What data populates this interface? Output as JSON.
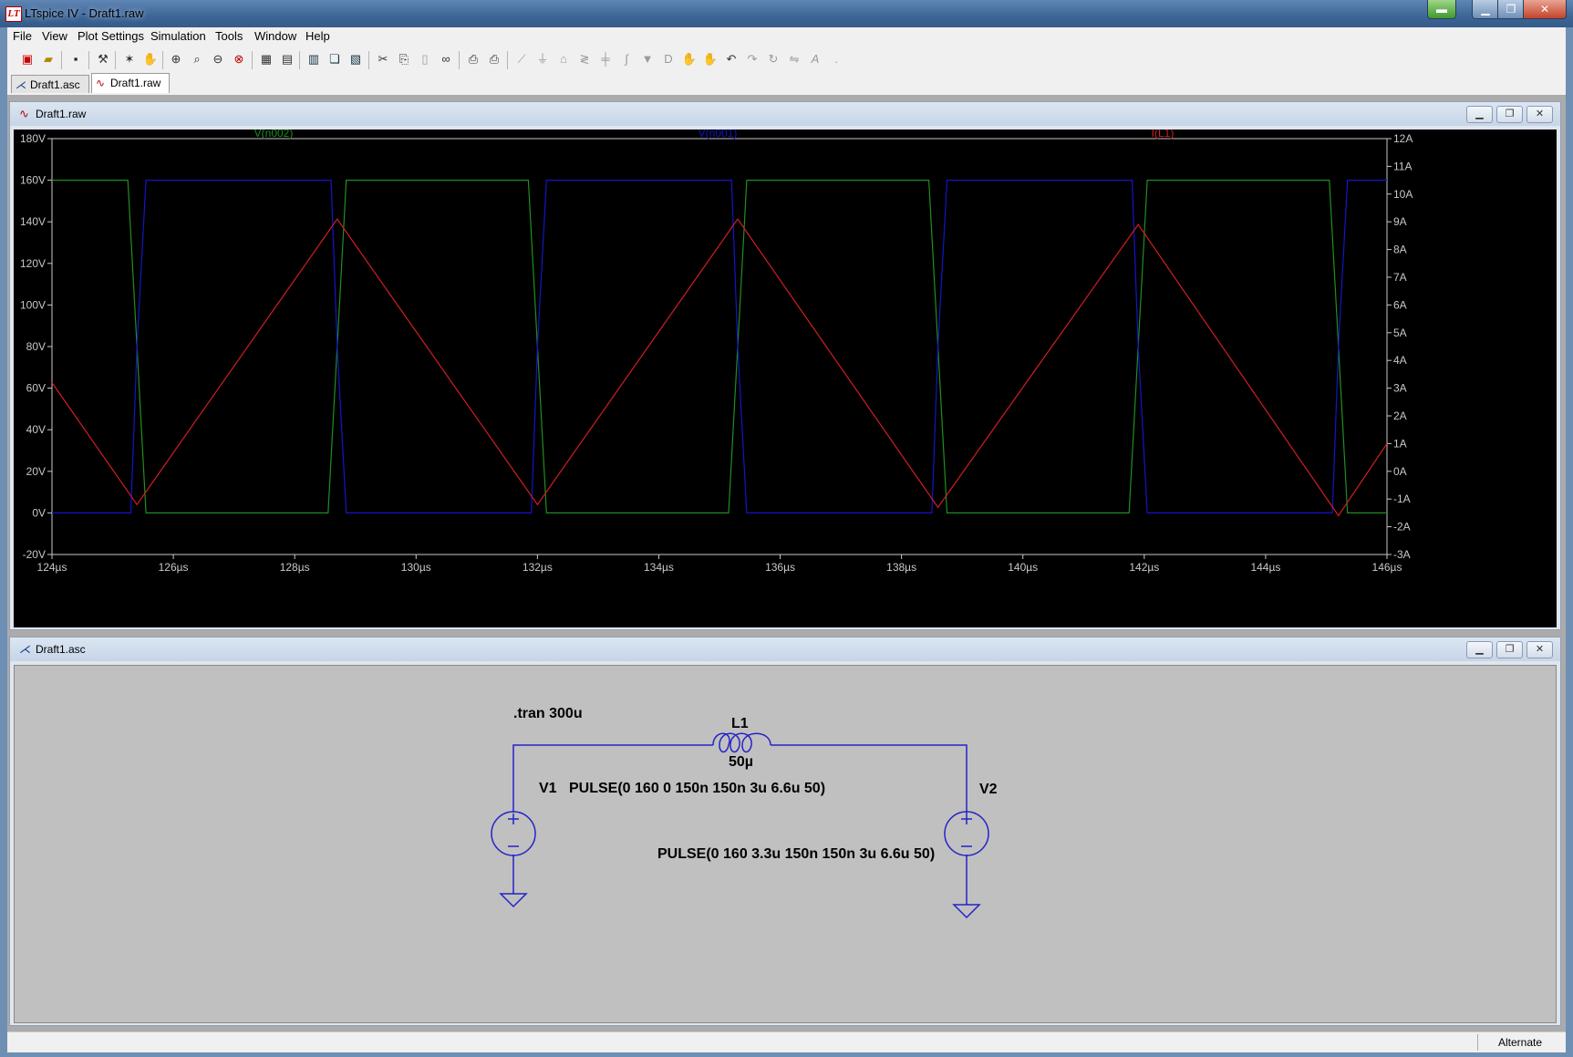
{
  "window": {
    "title": "LTspice IV - Draft1.raw",
    "app_icon": "LT"
  },
  "menu": [
    "File",
    "View",
    "Plot Settings",
    "Simulation",
    "Tools",
    "Window",
    "Help"
  ],
  "toolbar_icons": [
    "new-schematic-icon",
    "open-icon",
    "save-icon",
    "control-panel-icon",
    "run-icon",
    "halt-icon",
    "zoom-in-icon",
    "zoom-area-icon",
    "zoom-out-icon",
    "zoom-full-icon",
    "autorange-icon",
    "grid-icon",
    "tile-horizontal-icon",
    "cascade-icon",
    "tile-vertical-icon",
    "cut-icon",
    "copy-icon",
    "paste-icon",
    "find-icon",
    "print-preview-icon",
    "print-icon",
    "wire-icon",
    "ground-icon",
    "label-icon",
    "resistor-icon",
    "capacitor-icon",
    "inductor-icon",
    "diode-icon",
    "component-icon",
    "move-icon",
    "drag-icon",
    "undo-icon",
    "redo-icon",
    "rotate-icon",
    "mirror-icon",
    "text-icon",
    "spice-directive-icon"
  ],
  "tabs": [
    {
      "label": "Draft1.asc",
      "active": false
    },
    {
      "label": "Draft1.raw",
      "active": true
    }
  ],
  "plot_window": {
    "title": "Draft1.raw"
  },
  "schematic_window": {
    "title": "Draft1.asc"
  },
  "status": {
    "text": "Alternate"
  },
  "chart_data": {
    "type": "line",
    "xlabel": "",
    "ylabel": "",
    "x_ticks": [
      "124µs",
      "126µs",
      "128µs",
      "130µs",
      "132µs",
      "134µs",
      "136µs",
      "138µs",
      "140µs",
      "142µs",
      "144µs",
      "146µs"
    ],
    "xlim": [
      124,
      146
    ],
    "y_left_ticks": [
      "180V",
      "160V",
      "140V",
      "120V",
      "100V",
      "80V",
      "60V",
      "40V",
      "20V",
      "0V",
      "-20V"
    ],
    "ylim_left": [
      -20,
      180
    ],
    "y_right_ticks": [
      "12A",
      "11A",
      "10A",
      "9A",
      "8A",
      "7A",
      "6A",
      "5A",
      "4A",
      "3A",
      "2A",
      "1A",
      "0A",
      "-1A",
      "-2A",
      "-3A"
    ],
    "ylim_right": [
      -3,
      12
    ],
    "grid": false,
    "series": [
      {
        "name": "V(n002)",
        "color": "#1f8f1f",
        "axis": "left",
        "x": [
          124.0,
          125.25,
          125.4,
          125.55,
          128.55,
          128.7,
          128.85,
          131.85,
          132.0,
          132.15,
          135.15,
          135.3,
          135.45,
          138.45,
          138.6,
          138.75,
          141.75,
          141.9,
          142.05,
          145.05,
          145.2,
          145.35,
          146.0
        ],
        "y": [
          160,
          160,
          80,
          0,
          0,
          80,
          160,
          160,
          80,
          0,
          0,
          80,
          160,
          160,
          80,
          0,
          0,
          80,
          160,
          160,
          80,
          0,
          0
        ]
      },
      {
        "name": "V(n001)",
        "color": "#1414c8",
        "axis": "left",
        "x": [
          124.0,
          125.3,
          125.4,
          125.55,
          128.6,
          128.7,
          128.85,
          131.9,
          132.0,
          132.15,
          135.2,
          135.3,
          135.45,
          138.5,
          138.6,
          138.75,
          141.8,
          141.9,
          142.05,
          145.1,
          145.2,
          145.35,
          146.0
        ],
        "y": [
          0,
          0,
          80,
          160,
          160,
          80,
          0,
          0,
          80,
          160,
          160,
          80,
          0,
          0,
          80,
          160,
          160,
          80,
          0,
          0,
          80,
          160,
          160
        ]
      },
      {
        "name": "I(L1)",
        "color": "#d21e1e",
        "axis": "right",
        "x": [
          124.0,
          125.4,
          128.7,
          132.0,
          135.3,
          138.6,
          141.9,
          145.2,
          146.0
        ],
        "y": [
          3.2,
          -1.2,
          9.1,
          -1.2,
          9.1,
          -1.3,
          8.9,
          -1.6,
          1.0
        ]
      }
    ]
  },
  "schematic": {
    "directive": ".tran 300u",
    "inductor": {
      "ref": "L1",
      "value": "50µ"
    },
    "source1": {
      "ref": "V1",
      "value": "PULSE(0 160 0 150n 150n 3u 6.6u 50)"
    },
    "source2": {
      "ref": "V2",
      "value": "PULSE(0 160 3.3u 150n 150n 3u 6.6u 50)"
    },
    "wire_color": "#2323c8"
  }
}
